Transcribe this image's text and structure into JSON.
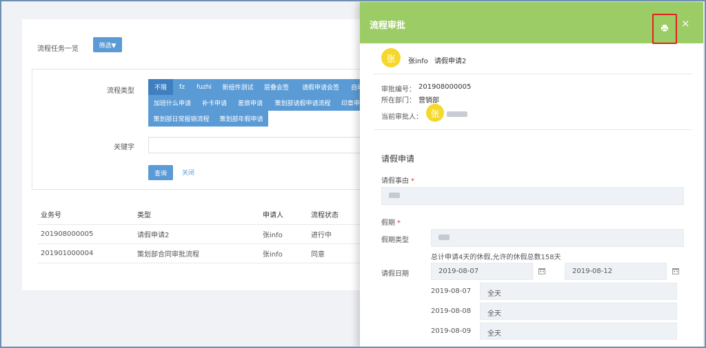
{
  "background": {
    "page_title": "流程任务一览",
    "filter_button": "筛选▼",
    "filter": {
      "type_label": "流程类型",
      "tags": [
        {
          "label": "不限",
          "active": true
        },
        {
          "label": "fz"
        },
        {
          "label": "fuzhi"
        },
        {
          "label": "新组件测试"
        },
        {
          "label": "层叠会签"
        },
        {
          "label": "请假申请会签"
        },
        {
          "label": "自动"
        },
        {
          "label": "加班什么申请"
        },
        {
          "label": "补卡申请"
        },
        {
          "label": "差旅申请"
        },
        {
          "label": "策划部请假申请流程"
        },
        {
          "label": "印章申"
        },
        {
          "label": "策划部日常报销流程"
        },
        {
          "label": "策划部年假申请"
        }
      ],
      "keyword_label": "关键字",
      "keyword_value": "",
      "query_button": "查询",
      "close_link": "关闭"
    },
    "table": {
      "headers": [
        "业务号",
        "类型",
        "申请人",
        "流程状态"
      ],
      "rows": [
        [
          "201908000005",
          "请假申请2",
          "张info",
          "进行中"
        ],
        [
          "201901000004",
          "策划部合同审批流程",
          "张info",
          "同意"
        ]
      ]
    }
  },
  "drawer": {
    "title": "流程审批",
    "header_color": "#9ccc65",
    "highlight_color": "#e02020",
    "icons": {
      "print": "printer-icon",
      "close": "close-icon",
      "calendar": "calendar-icon"
    },
    "close_glyph": "×",
    "applicant": {
      "avatar_char": "张",
      "name": "张info",
      "flow_name": "请假申请2"
    },
    "info": {
      "number_label": "审批编号：",
      "number_value": "201908000005",
      "dept_label": "所在部门：",
      "dept_value": "营销部",
      "approver_label": "当前审批人：",
      "approver_avatar": "张"
    },
    "form": {
      "section_title": "请假申请",
      "reason_label": "请假事由",
      "required_mark": "*",
      "period_label": "假期",
      "leave_type_label": "假期类型",
      "summary": "总计申请4天的休假,允许的休假总数158天",
      "date_label": "请假日期",
      "start_date": "2019-08-07",
      "end_date": "2019-08-12",
      "days": [
        {
          "date": "2019-08-07",
          "value": "全天"
        },
        {
          "date": "2019-08-08",
          "value": "全天"
        },
        {
          "date": "2019-08-09",
          "value": "全天"
        }
      ]
    }
  }
}
